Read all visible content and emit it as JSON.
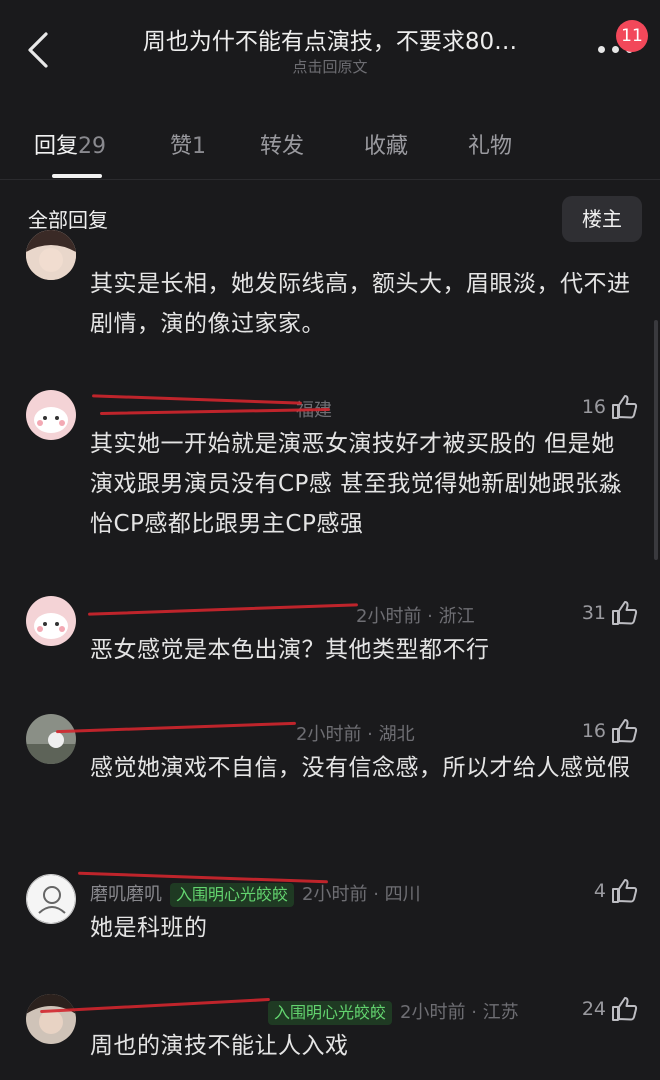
{
  "header": {
    "title": "周也为什不能有点演技，不要求80…",
    "subtitle": "点击回原文",
    "notification_count": "11"
  },
  "tabs": [
    {
      "label": "回复",
      "count": "29",
      "active": true
    },
    {
      "label": "赞",
      "count": "1",
      "active": false
    },
    {
      "label": "转发",
      "count": "",
      "active": false
    },
    {
      "label": "收藏",
      "count": "",
      "active": false
    },
    {
      "label": "礼物",
      "count": "",
      "active": false
    }
  ],
  "filter": {
    "all_replies": "全部回复",
    "owner_button": "楼主"
  },
  "comments": [
    {
      "text": "其实是长相，她发际线高，额头大，眉眼淡，代不进剧情，演的像过家家。"
    },
    {
      "time": "",
      "location": "福建",
      "likes": "16",
      "text": "其实她一开始就是演恶女演技好才被买股的 但是她演戏跟男演员没有CP感 甚至我觉得她新剧她跟张淼怡CP感都比跟男主CP感强"
    },
    {
      "time": "2小时前",
      "location": "浙江",
      "likes": "31",
      "text": "恶女感觉是本色出演？其他类型都不行"
    },
    {
      "time": "2小时前",
      "location": "湖北",
      "likes": "16",
      "text": "感觉她演戏不自信，没有信念感，所以才给人感觉假"
    },
    {
      "name": "磨叽磨叽",
      "tag": "入围明心光皎皎",
      "time": "2小时前",
      "location": "四川",
      "likes": "4",
      "text": "她是科班的"
    },
    {
      "tag": "入围明心光皎皎",
      "time": "2小时前",
      "location": "江苏",
      "likes": "24",
      "text": "周也的演技不能让人入戏"
    }
  ],
  "colors": {
    "background": "#1a1a1c",
    "badge": "#f2485a",
    "tag_green": "#63d46f"
  }
}
